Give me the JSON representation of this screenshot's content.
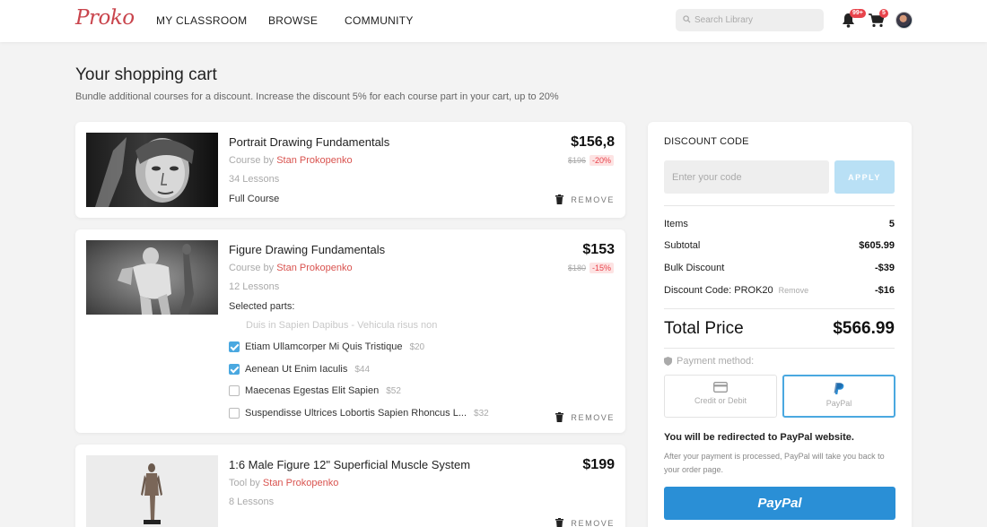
{
  "header": {
    "logo": "Proko",
    "nav": [
      "MY CLASSROOM",
      "BROWSE",
      "COMMUNITY"
    ],
    "search_placeholder": "Search Library",
    "notifications_badge": "99+",
    "cart_badge": "5"
  },
  "page": {
    "title": "Your shopping cart",
    "subtitle": "Bundle additional courses for a discount. Increase the discount 5% for each course part in your cart, up to 20%"
  },
  "cart": [
    {
      "title": "Portrait Drawing Fundamentals",
      "by_prefix": "Course by",
      "author": "Stan Prokopenko",
      "lessons": "34 Lessons",
      "label": "Full Course",
      "price": "$156,8",
      "old_price": "$196",
      "discount": "-20%",
      "remove": "REMOVE"
    },
    {
      "title": "Figure Drawing Fundamentals",
      "by_prefix": "Course by",
      "author": "Stan Prokopenko",
      "lessons": "12 Lessons",
      "label": "Selected parts:",
      "price": "$153",
      "old_price": "$180",
      "discount": "-15%",
      "remove": "REMOVE",
      "parts": [
        {
          "name": "Duis in Sapien Dapibus - Vehicula risus non",
          "price": "",
          "checked": false,
          "disabled": true
        },
        {
          "name": "Etiam Ullamcorper Mi Quis Tristique",
          "price": "$20",
          "checked": true,
          "disabled": false
        },
        {
          "name": "Aenean Ut Enim Iaculis",
          "price": "$44",
          "checked": true,
          "disabled": false
        },
        {
          "name": "Maecenas Egestas Elit Sapien",
          "price": "$52",
          "checked": false,
          "disabled": false
        },
        {
          "name": "Suspendisse Ultrices Lobortis Sapien Rhoncus L...",
          "price": "$32",
          "checked": false,
          "disabled": false
        }
      ]
    },
    {
      "title": "1:6 Male Figure 12\" Superficial Muscle System",
      "by_prefix": "Tool by",
      "author": "Stan Prokopenko",
      "lessons": "8 Lessons",
      "price": "$199",
      "remove": "REMOVE"
    }
  ],
  "summary": {
    "discount_heading": "DISCOUNT CODE",
    "code_placeholder": "Enter your code",
    "apply": "APPLY",
    "rows": [
      {
        "label": "Items",
        "value": "5"
      },
      {
        "label": "Subtotal",
        "value": "$605.99"
      },
      {
        "label": "Bulk Discount",
        "value": "-$39"
      },
      {
        "label": "Discount Code: PROK20",
        "value": "-$16",
        "remove": "Remove"
      }
    ],
    "total_label": "Total Price",
    "total_value": "$566.99",
    "payment_label": "Payment method:",
    "methods": [
      "Credit or Debit",
      "PayPal"
    ],
    "selected_method": "PayPal",
    "redirect_title": "You will be redirected to PayPal website.",
    "redirect_note": "After your payment is processed, PayPal will take you back to your order page.",
    "pay_button": "PayPal"
  },
  "colors": {
    "accent": "#4aa8e0",
    "author_link": "#d9534f",
    "discount": "#e8434b",
    "paypal": "#2a8fd6"
  }
}
